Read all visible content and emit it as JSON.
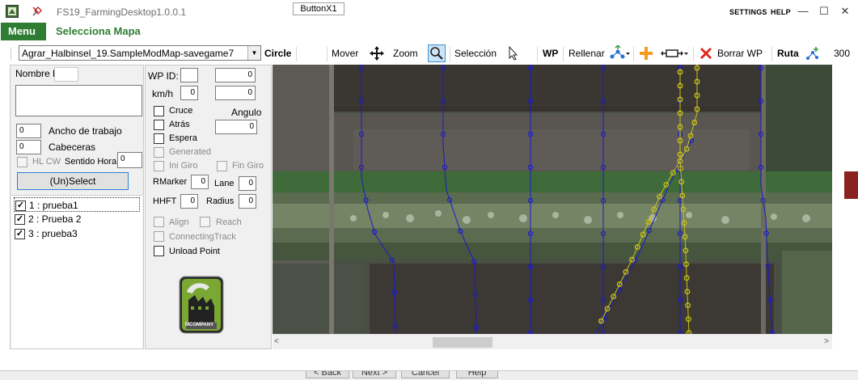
{
  "titlebar": {
    "app_title": "FS19_FarmingDesktop1.0.0.1",
    "button_x1": "ButtonX1",
    "settings": "SETTINGS",
    "help": "HELP",
    "minimize": "—",
    "maximize": "☐",
    "close": "✕"
  },
  "menubar": {
    "menu_label": "Menu",
    "title": "Selecciona Mapa"
  },
  "toolbar": {
    "map_value": "Agrar_Halbinsel_19.SampleModMap-savegame7",
    "circle": "Circle",
    "mover": "Mover",
    "zoom": "Zoom",
    "seleccion": "Selección",
    "wp": "WP",
    "rellenar": "Rellenar",
    "borrar_wp": "Borrar WP",
    "ruta": "Ruta",
    "zoom_value": "300"
  },
  "left_panel": {
    "nombre_ruta_label": "Nombre Ruta:",
    "ancho_value": "0",
    "ancho_label": "Ancho de trabajo",
    "cabeceras_value": "0",
    "cabeceras_label": "Cabeceras",
    "hl_cw_label": "HL CW",
    "sentido_label": "Sentido Horario",
    "sentido_value": "0",
    "unselect_label": "(Un)Select",
    "routes": [
      {
        "label": "1 : prueba1",
        "checked": true
      },
      {
        "label": "2 : Prueba 2",
        "checked": true
      },
      {
        "label": "3 : prueba3",
        "checked": true
      }
    ]
  },
  "mid_panel": {
    "wp_id_label": "WP ID:",
    "wp_id_value": "",
    "field_a": "0",
    "kmh_label": "km/h",
    "kmh_value": "0",
    "field_b": "0",
    "cruce": "Cruce",
    "angulo_label": "Angulo",
    "angulo_value": "0",
    "atras": "Atrás",
    "espera": "Espera",
    "generated": "Generated",
    "ini_giro": "Ini Giro",
    "fin_giro": "Fin Giro",
    "rmarker_label": "RMarker",
    "rmarker_value": "0",
    "lane_label": "Lane",
    "lane_value": "0",
    "hhft_label": "HHFT",
    "hhft_value": "0",
    "radius_label": "Radius",
    "radius_value": "0",
    "align": "Align",
    "reach": "Reach",
    "connecting_track": "ConnectingTrack",
    "unload_point": "Unload Point",
    "logo_text": "MCOMPANY"
  },
  "bottom_strip": {
    "back": "< Back",
    "next": "Next >",
    "cancel": "Cancel",
    "help": "Help"
  },
  "colors": {
    "accent_green": "#2e7d32",
    "route_blue": "#1a1acc",
    "route_yellow": "#c8c21a",
    "marker_red": "#8b2222"
  },
  "icons": [
    "app-icon",
    "pin-icon",
    "move-icon",
    "magnifier-icon",
    "cursor-icon",
    "fill-icon",
    "plus-icon",
    "connector-icon",
    "delete-x-icon",
    "route-icon",
    "mcompany-logo"
  ]
}
